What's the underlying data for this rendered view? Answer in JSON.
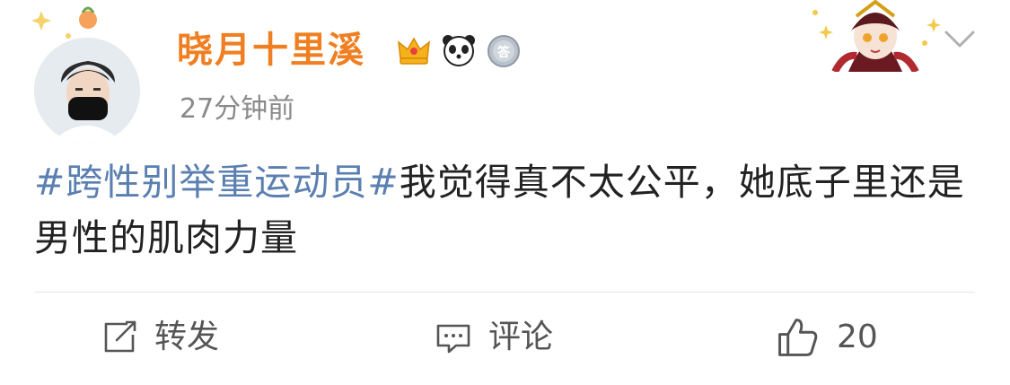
{
  "post": {
    "author": {
      "name": "晓月十里溪"
    },
    "badges": [
      "crown-icon",
      "panda-icon",
      "answer-medal-icon"
    ],
    "timestamp": "27分钟前",
    "topic": "#跨性别举重运动员#",
    "text": "我觉得真不太公平，她底子里还是男性的肌肉力量"
  },
  "actions": {
    "repost_label": "转发",
    "comment_label": "评论",
    "like_count": "20"
  },
  "colors": {
    "username": "#f07f21",
    "topic": "#5a7fb0",
    "timestamp": "#8a8a8a",
    "text": "#222222"
  }
}
